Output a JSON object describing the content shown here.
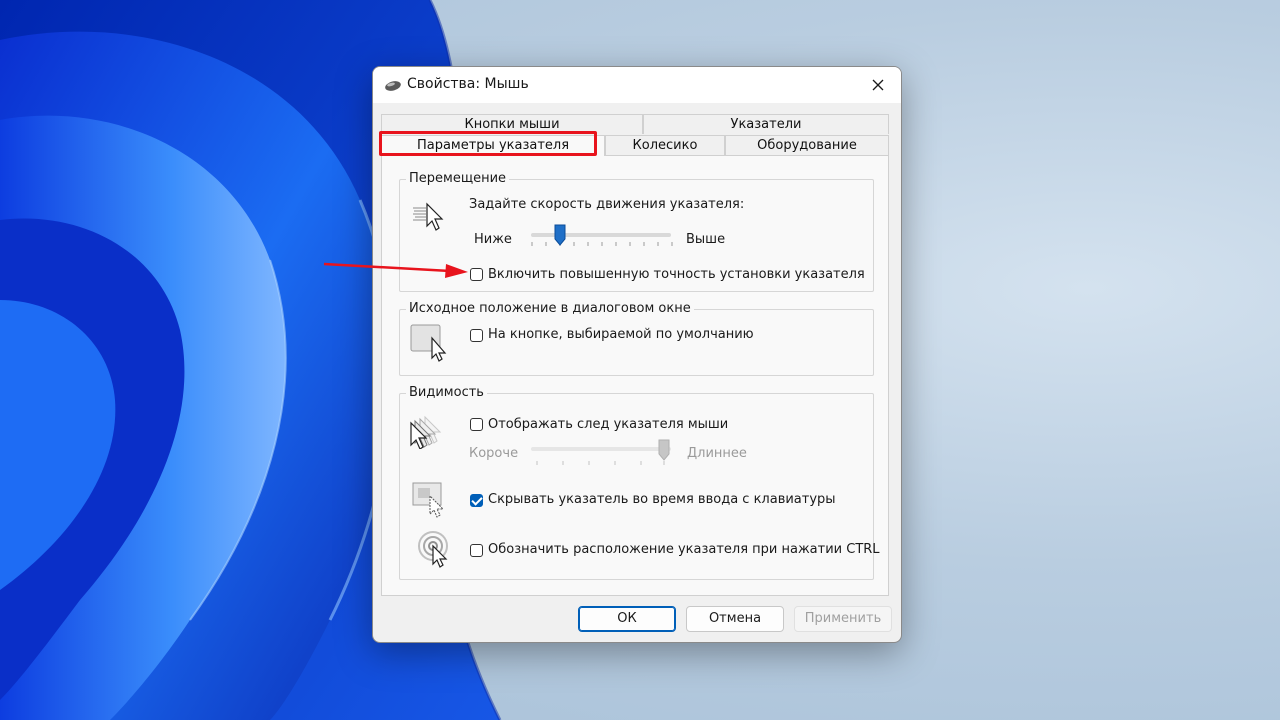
{
  "window": {
    "title": "Свойства: Мышь",
    "icon": "mouse-icon",
    "close_icon": "close-icon"
  },
  "tabs": [
    {
      "label": "Кнопки мыши",
      "active": false
    },
    {
      "label": "Указатели",
      "active": false
    },
    {
      "label": "Параметры указателя",
      "active": true
    },
    {
      "label": "Колесико",
      "active": false
    },
    {
      "label": "Оборудование",
      "active": false
    }
  ],
  "motion": {
    "group_title": "Перемещение",
    "speed_label": "Задайте скорость движения указателя:",
    "slow_label": "Ниже",
    "fast_label": "Выше",
    "speed_level": 3,
    "speed_max": 11,
    "precision_label": "Включить повышенную точность установки указателя",
    "precision_checked": false
  },
  "snap_to": {
    "group_title": "Исходное положение в диалоговом окне",
    "default_button_label": "На кнопке, выбираемой по умолчанию",
    "checked": false
  },
  "visibility": {
    "group_title": "Видимость",
    "trails_label": "Отображать след указателя мыши",
    "trails_checked": false,
    "short_label": "Короче",
    "long_label": "Длиннее",
    "trail_level": 6,
    "trail_max": 6,
    "hide_label": "Скрывать указатель во время ввода с клавиатуры",
    "hide_checked": true,
    "ctrl_label": "Обозначить расположение указателя при нажатии CTRL",
    "ctrl_checked": false
  },
  "buttons": {
    "ok": "ОК",
    "cancel": "Отмена",
    "apply": "Применить"
  },
  "colors": {
    "accent": "#005fb8",
    "annotation": "#e8141d",
    "wallpaper_blue": "#1a56e8"
  }
}
